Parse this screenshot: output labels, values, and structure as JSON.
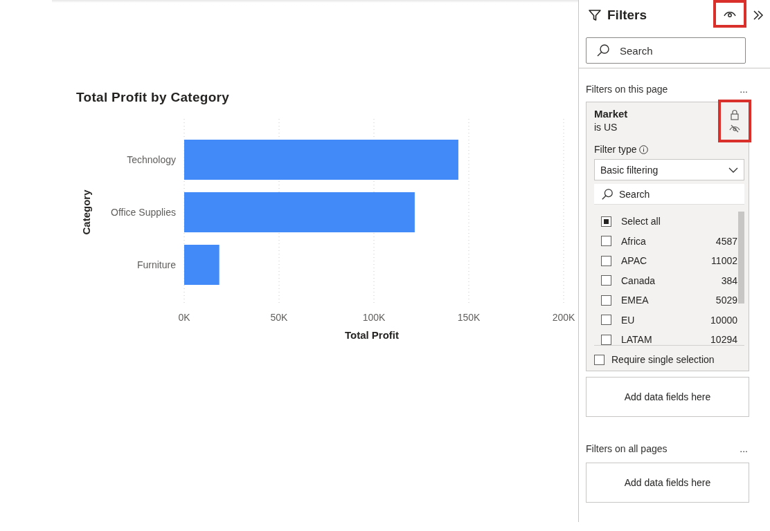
{
  "chart": {
    "title": "Total Profit by Category",
    "chart_data": {
      "type": "bar",
      "orientation": "horizontal",
      "xlabel": "Total Profit",
      "ylabel": "Category",
      "categories": [
        "Technology",
        "Office Supplies",
        "Furniture"
      ],
      "values": [
        144500,
        121500,
        18500
      ],
      "grid": true,
      "xlim": [
        0,
        200000
      ],
      "xticks": [
        {
          "value": 0,
          "label": "0K"
        },
        {
          "value": 50000,
          "label": "50K"
        },
        {
          "value": 100000,
          "label": "100K"
        },
        {
          "value": 150000,
          "label": "150K"
        },
        {
          "value": 200000,
          "label": "200K"
        }
      ]
    }
  },
  "filters_pane": {
    "title": "Filters",
    "search": {
      "placeholder": "Search"
    },
    "page_section": {
      "label": "Filters on this page",
      "more": "...",
      "card": {
        "field": "Market",
        "summary": "is US",
        "filter_type_label": "Filter type",
        "filter_type": "Basic filtering",
        "search": {
          "placeholder": "Search"
        },
        "select_all": {
          "label": "Select all",
          "indeterminate": true
        },
        "items": [
          {
            "label": "Africa",
            "count": "4587",
            "checked": false
          },
          {
            "label": "APAC",
            "count": "11002",
            "checked": false
          },
          {
            "label": "Canada",
            "count": "384",
            "checked": false
          },
          {
            "label": "EMEA",
            "count": "5029",
            "checked": false
          },
          {
            "label": "EU",
            "count": "10000",
            "checked": false
          },
          {
            "label": "LATAM",
            "count": "10294",
            "checked": false
          }
        ],
        "require_single": {
          "label": "Require single selection",
          "checked": false
        }
      },
      "drop_zone": "Add data fields here"
    },
    "all_pages_section": {
      "label": "Filters on all pages",
      "more": "...",
      "drop_zone": "Add data fields here"
    }
  }
}
